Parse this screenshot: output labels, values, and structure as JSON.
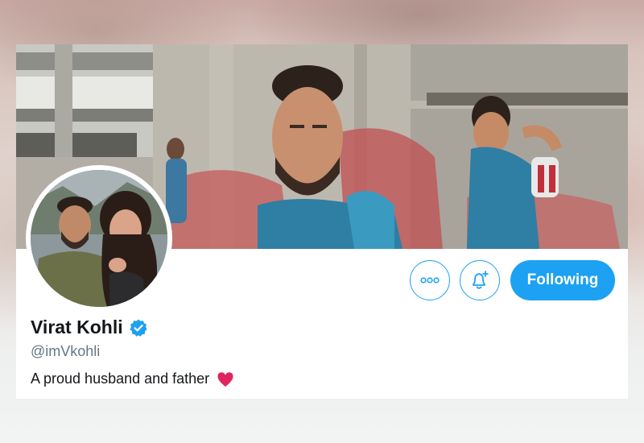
{
  "profile": {
    "display_name": "Virat Kohli",
    "verified": true,
    "handle": "@imVkohli",
    "bio": "A proud husband and father",
    "bio_emoji": "red-heart-icon"
  },
  "actions": {
    "more_icon": "more-horizontal-icon",
    "notify_icon": "bell-plus-icon",
    "follow_label": "Following"
  },
  "colors": {
    "accent": "#1da1f2",
    "name_text": "#14171a",
    "handle_text": "#657786",
    "heart": "#e0245e"
  }
}
